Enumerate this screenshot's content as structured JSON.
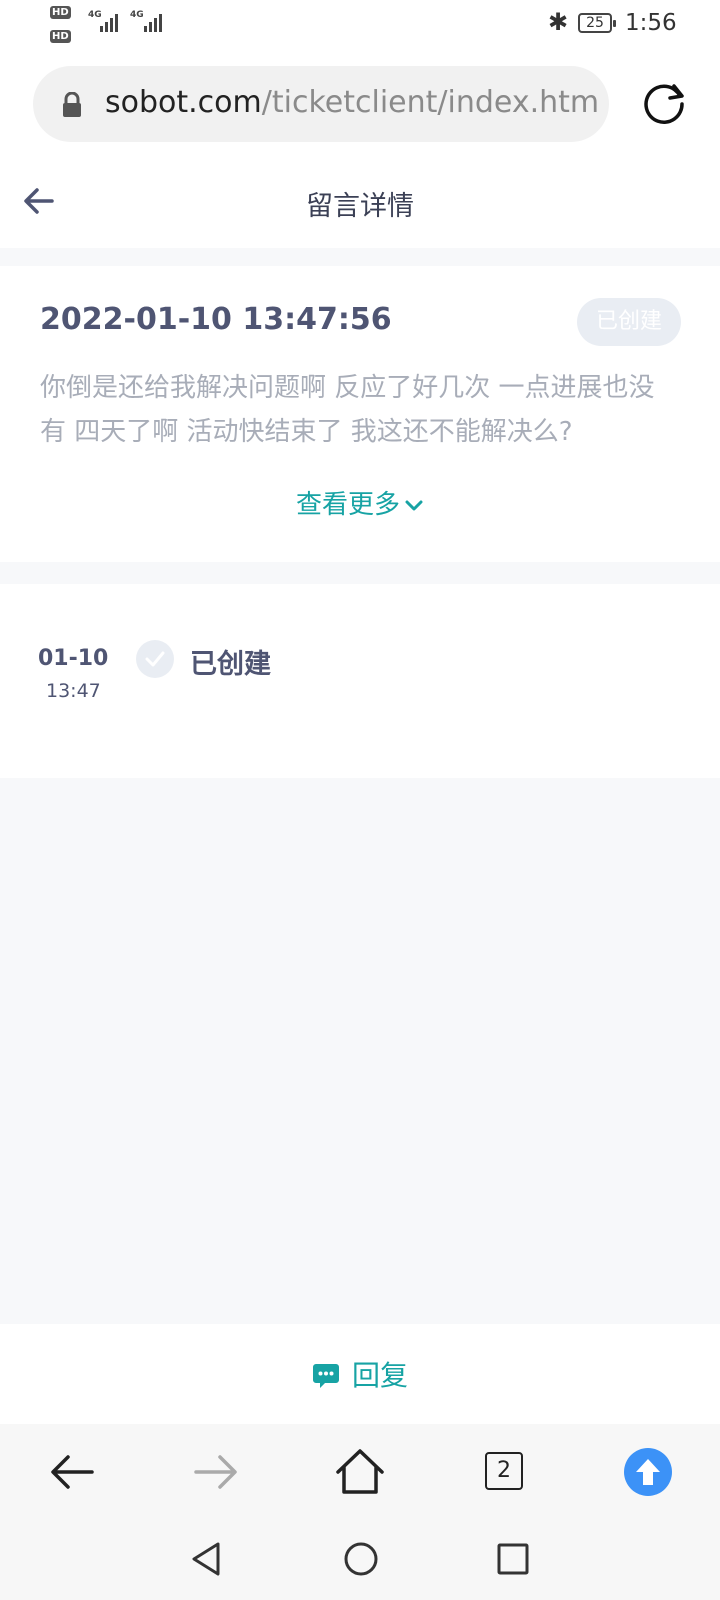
{
  "status_bar": {
    "sim1": "HD",
    "sim2": "HD",
    "network1": "4G",
    "network2": "4G",
    "battery": "25",
    "time": "1:56"
  },
  "browser": {
    "url_domain": "sobot.com",
    "url_path": "/ticketclient/index.html"
  },
  "header": {
    "title": "留言详情"
  },
  "message": {
    "timestamp": "2022-01-10 13:47:56",
    "status": "已创建",
    "body": "你倒是还给我解决问题啊 反应了好几次 一点进展也没有 四天了啊 活动快结束了 我这还不能解决么?",
    "show_more": "查看更多"
  },
  "timeline": [
    {
      "date": "01-10",
      "time": "13:47",
      "status": "已创建"
    }
  ],
  "reply": {
    "label": "回复"
  },
  "toolbar": {
    "tab_count": "2"
  },
  "colors": {
    "accent": "#17a3a4",
    "title_text": "#4f5573",
    "muted_text": "#a8adb8",
    "badge_bg": "#e9edf3",
    "upload_blue": "#3c92f7"
  }
}
